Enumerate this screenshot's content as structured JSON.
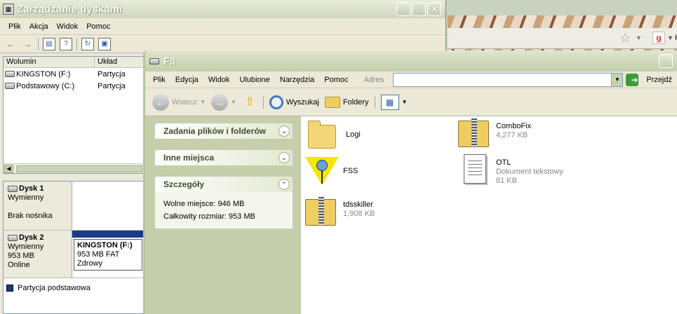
{
  "disk_mgmt": {
    "title": "Zarządzanie dyskami",
    "menu": [
      "Plik",
      "Akcja",
      "Widok",
      "Pomoc"
    ],
    "columns": [
      "Wolumin",
      "Układ"
    ],
    "volumes": [
      {
        "name": "KINGSTON (F:)",
        "layout": "Partycja"
      },
      {
        "name": "Podstawowy (C:)",
        "layout": "Partycja"
      }
    ],
    "disks": [
      {
        "name": "Dysk 1",
        "type": "Wymienny",
        "size": "",
        "status": "Brak nośnika"
      },
      {
        "name": "Dysk 2",
        "type": "Wymienny",
        "size": "953 MB",
        "status": "Online"
      }
    ],
    "partition": {
      "label": "KINGSTON  (F:)",
      "detail": "953 MB FAT",
      "health": "Zdrowy"
    },
    "legend": "Partycja podstawowa",
    "colors": {
      "partition": "#1a3a8c"
    }
  },
  "browser": {
    "partial_text": "H"
  },
  "explorer": {
    "title": "F:\\",
    "menu": [
      "Plik",
      "Edycja",
      "Widok",
      "Ulubione",
      "Narzędzia",
      "Pomoc"
    ],
    "address_label": "Adres",
    "address_value": "",
    "go_label": "Przejdź",
    "toolbar": {
      "back": "Wstecz",
      "search": "Wyszukaj",
      "folders": "Foldery"
    },
    "panels": {
      "tasks": "Zadania plików i folderów",
      "other": "Inne miejsca",
      "details": "Szczegóły",
      "free": "Wolne miejsce: 946 MB",
      "total": "Całkowity rozmiar: 953 MB"
    },
    "files": [
      {
        "name": "Logi",
        "sub": "",
        "icon": "folder-icon"
      },
      {
        "name": "ComboFix",
        "sub": "4,277 KB",
        "icon": "zip-icon"
      },
      {
        "name": "FSS",
        "sub": "",
        "icon": "fss-icon"
      },
      {
        "name": "OTL",
        "sub": "Dokument tekstowy",
        "sub2": "81 KB",
        "icon": "text-document-icon"
      },
      {
        "name": "tdsskiller",
        "sub": "1,908 KB",
        "icon": "zip-icon"
      }
    ]
  }
}
